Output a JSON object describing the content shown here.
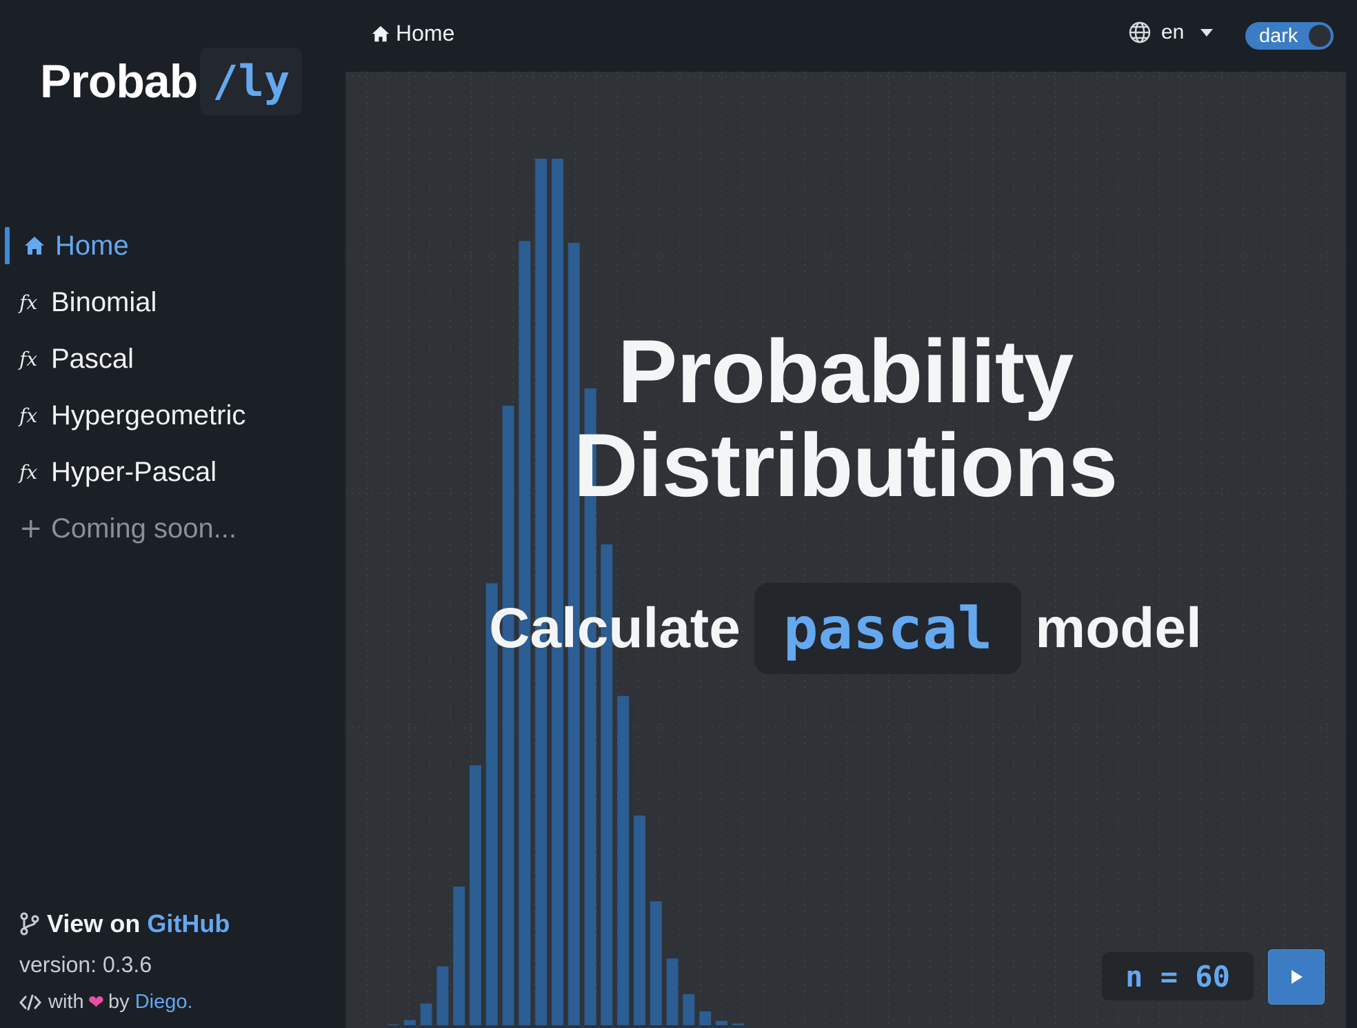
{
  "app": {
    "logo_main": "Probab",
    "logo_code": "/ly"
  },
  "sidebar": {
    "items": [
      {
        "label": "Home",
        "icon": "home-icon"
      },
      {
        "label": "Binomial",
        "icon": "fx-icon"
      },
      {
        "label": "Pascal",
        "icon": "fx-icon"
      },
      {
        "label": "Hypergeometric",
        "icon": "fx-icon"
      },
      {
        "label": "Hyper-Pascal",
        "icon": "fx-icon"
      },
      {
        "label": "Coming soon...",
        "icon": "plus-icon"
      }
    ],
    "github_prefix": "View on",
    "github_link": "GitHub",
    "version": "version: 0.3.6",
    "credits_with": "with",
    "credits_by": "by",
    "credits_author": "Diego."
  },
  "topbar": {
    "breadcrumb": "Home",
    "language": "en",
    "theme": "dark"
  },
  "hero": {
    "title_line1": "Probability",
    "title_line2": "Distributions",
    "sub_prefix": "Calculate",
    "model": "pascal",
    "sub_suffix": "model"
  },
  "controls": {
    "n_label": "n = 60"
  },
  "colors": {
    "accent": "#64a8f0",
    "bar": "#2c5d93",
    "sidebar_bg": "#1b1f26",
    "panel_bg": "#2f3236"
  },
  "chart_data": {
    "type": "bar",
    "values": [
      0.001,
      0.006,
      0.025,
      0.068,
      0.16,
      0.3,
      0.51,
      0.715,
      0.905,
      1.0,
      1.0,
      0.903,
      0.735,
      0.555,
      0.38,
      0.242,
      0.143,
      0.077,
      0.036,
      0.016,
      0.005,
      0.002
    ],
    "ylim": [
      0,
      1.1
    ],
    "grid": true
  }
}
